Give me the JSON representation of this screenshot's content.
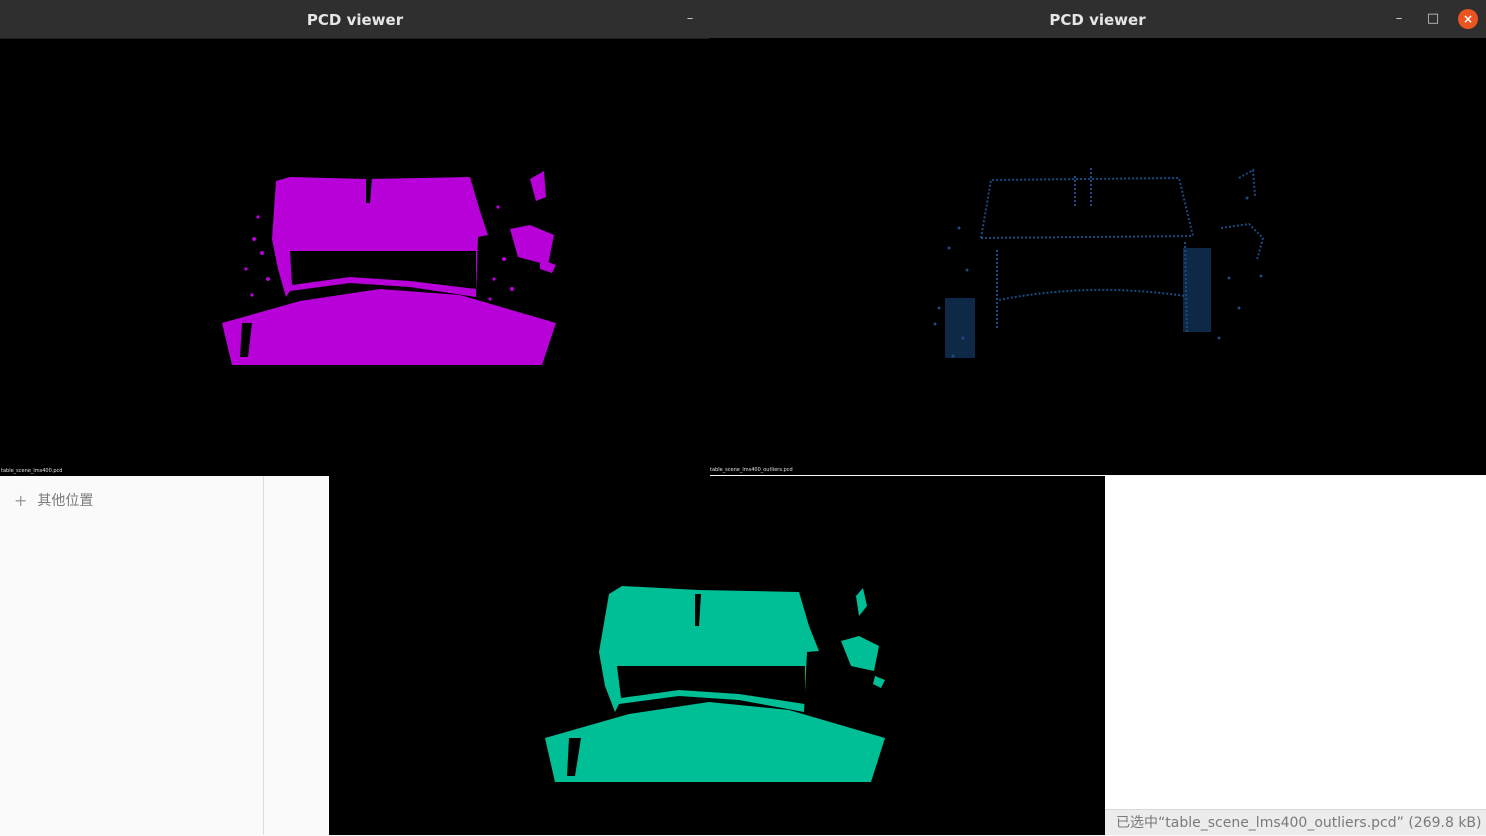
{
  "file_manager": {
    "other_locations_label": "其他位置",
    "status_text": "已选中“table_scene_lms400_outliers.pcd” (269.8 kB)"
  },
  "windows": {
    "left": {
      "title": "PCD viewer",
      "cloud_label": "table_scene_lms400.pcd",
      "cloud_color": "#b800d8"
    },
    "right": {
      "title": "PCD viewer",
      "cloud_label": "table_scene_lms400_outliers.pcd",
      "cloud_color": "#1a4a80",
      "close_color": "#e95420"
    },
    "bottom": {
      "cloud_color": "#00be96"
    }
  },
  "icons": {
    "minimize": "minimize-icon",
    "maximize": "maximize-icon",
    "close": "close-icon",
    "add": "plus-icon"
  }
}
